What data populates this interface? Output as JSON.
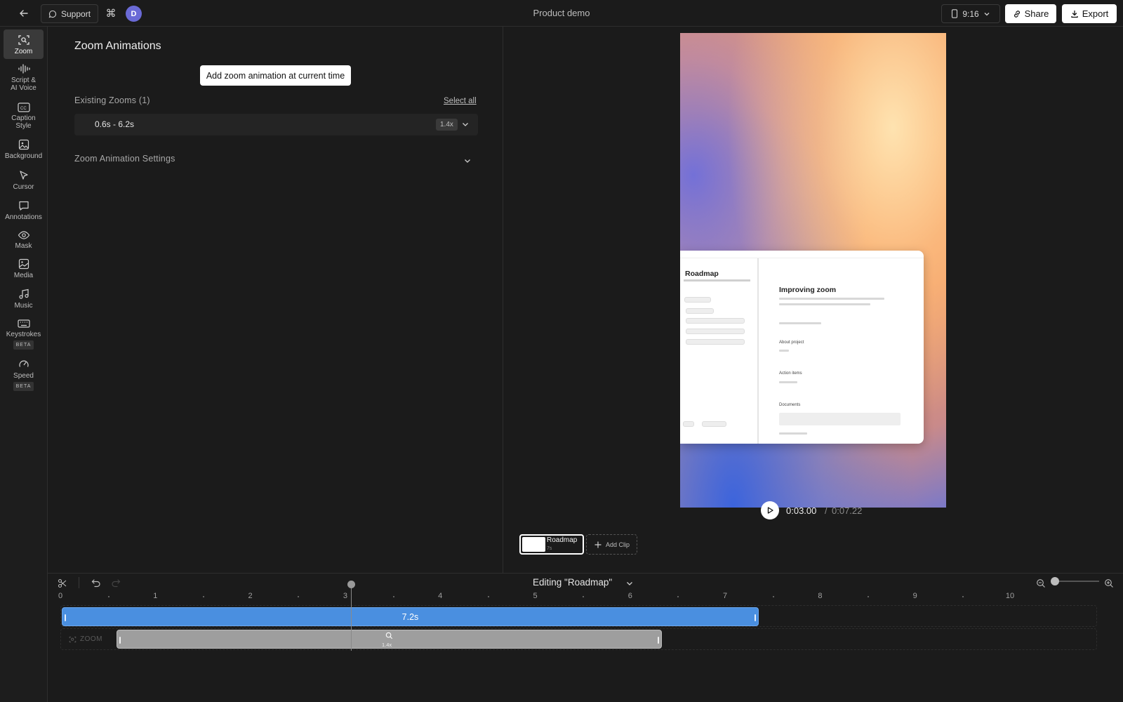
{
  "topbar": {
    "support_label": "Support",
    "avatar_initial": "D",
    "doc_title": "Product demo",
    "aspect_ratio": "9:16",
    "share_label": "Share",
    "export_label": "Export"
  },
  "toolrail": {
    "items": [
      {
        "label": "Zoom",
        "icon": "zoom-icon",
        "active": true
      },
      {
        "label": "Script &\nAI Voice",
        "icon": "waveform-icon"
      },
      {
        "label": "Caption\nStyle",
        "icon": "caption-icon"
      },
      {
        "label": "Background",
        "icon": "image-icon"
      },
      {
        "label": "Cursor",
        "icon": "cursor-icon"
      },
      {
        "label": "Annotations",
        "icon": "comment-icon"
      },
      {
        "label": "Mask",
        "icon": "eye-icon"
      },
      {
        "label": "Media",
        "icon": "media-icon"
      },
      {
        "label": "Music",
        "icon": "music-icon"
      },
      {
        "label": "Keystrokes",
        "icon": "keyboard-icon",
        "badge": "BETA"
      },
      {
        "label": "Speed",
        "icon": "gauge-icon",
        "badge": "BETA"
      }
    ]
  },
  "panel": {
    "title": "Zoom Animations",
    "add_button": "Add zoom animation at current time",
    "existing_label": "Existing Zooms (1)",
    "select_all": "Select all",
    "zooms": [
      {
        "range": "0.6s - 6.2s",
        "level": "1.4x"
      }
    ],
    "settings_label": "Zoom Animation Settings"
  },
  "preview": {
    "screenshot": {
      "left_title": "Roadmap",
      "right_title": "Improving zoom",
      "about": "About project",
      "actions": "Action items",
      "documents": "Documents"
    },
    "current_time": "0:03.00",
    "separator": "/",
    "total_time": "0:07.22",
    "clips": [
      {
        "name": "Roadmap",
        "duration": "7s"
      }
    ],
    "add_clip_label": "Add Clip"
  },
  "timeline": {
    "editing_label": "Editing \"Roadmap\"",
    "ruler_labels": [
      "0",
      "1",
      "2",
      "3",
      "4",
      "5",
      "6",
      "7",
      "8",
      "9",
      "10"
    ],
    "clip_bar_label": "7.2s",
    "zoom_track_label": "ZOOM",
    "zoom_bar_level": "1.4x",
    "playhead_seconds": 3.0
  },
  "colors": {
    "accent_blue": "#4a8fe0",
    "background": "#1b1b1b",
    "avatar": "#6a6ad6"
  }
}
